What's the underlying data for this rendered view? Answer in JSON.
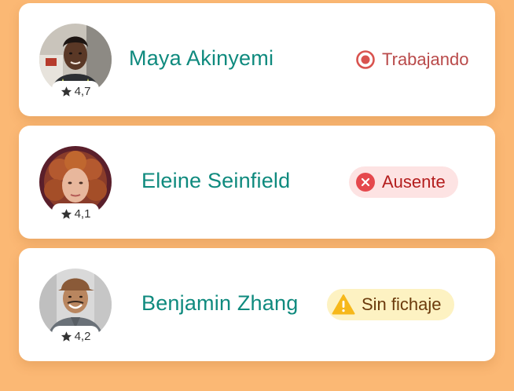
{
  "colors": {
    "background": "#fbb874",
    "name_text": "#0f8a7e",
    "working": "#b94a4a",
    "absent_bg": "#fde3e3",
    "absent_text": "#b41e1e",
    "nocheck_bg": "#fdf2c2",
    "nocheck_text": "#6b3a0c"
  },
  "employees": [
    {
      "name": "Maya Akinyemi",
      "rating": "4,7",
      "status": {
        "label": "Trabajando",
        "icon": "record-icon"
      },
      "avatar": "avatar-photo"
    },
    {
      "name": "Eleine Seinfield",
      "rating": "4,1",
      "status": {
        "label": "Ausente",
        "icon": "x-circle-icon"
      },
      "avatar": "avatar-photo"
    },
    {
      "name": "Benjamin Zhang",
      "rating": "4,2",
      "status": {
        "label": "Sin fichaje",
        "icon": "warning-icon"
      },
      "avatar": "avatar-photo"
    }
  ]
}
